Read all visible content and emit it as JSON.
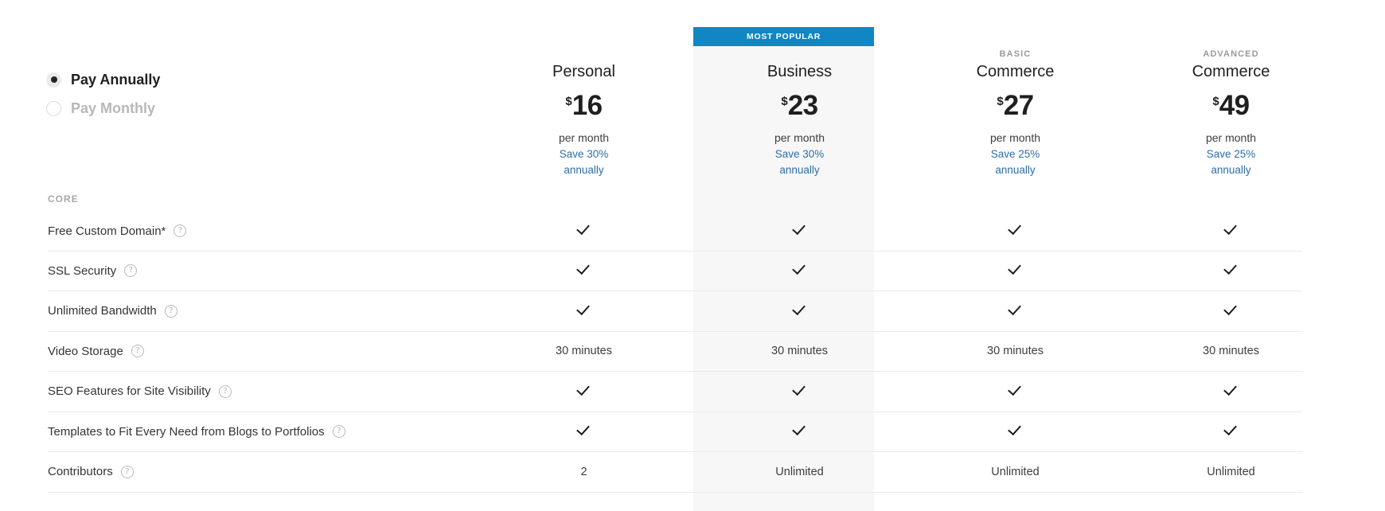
{
  "billing": {
    "options": [
      {
        "label": "Pay Annually",
        "selected": true
      },
      {
        "label": "Pay Monthly",
        "selected": false
      }
    ]
  },
  "popular_badge": "MOST POPULAR",
  "accent_color": "#1086c3",
  "link_color": "#2c6ea8",
  "highlight_color": "#f7f7f7",
  "plans": [
    {
      "eyebrow": "",
      "name": "Personal",
      "currency": "$",
      "amount": "16",
      "period": "per month",
      "save_line1": "Save 30%",
      "save_line2": "annually",
      "highlighted": false
    },
    {
      "eyebrow": "",
      "name": "Business",
      "currency": "$",
      "amount": "23",
      "period": "per month",
      "save_line1": "Save 30%",
      "save_line2": "annually",
      "highlighted": true
    },
    {
      "eyebrow": "BASIC",
      "name": "Commerce",
      "currency": "$",
      "amount": "27",
      "period": "per month",
      "save_line1": "Save 25%",
      "save_line2": "annually",
      "highlighted": false
    },
    {
      "eyebrow": "ADVANCED",
      "name": "Commerce",
      "currency": "$",
      "amount": "49",
      "period": "per month",
      "save_line1": "Save 25%",
      "save_line2": "annually",
      "highlighted": false
    }
  ],
  "section": {
    "label": "CORE"
  },
  "help_glyph": "?",
  "features": [
    {
      "label": "Free Custom Domain*",
      "has_help": true,
      "values": [
        "check",
        "check",
        "check",
        "check"
      ]
    },
    {
      "label": "SSL Security",
      "has_help": true,
      "values": [
        "check",
        "check",
        "check",
        "check"
      ]
    },
    {
      "label": "Unlimited Bandwidth",
      "has_help": true,
      "values": [
        "check",
        "check",
        "check",
        "check"
      ]
    },
    {
      "label": "Video Storage",
      "has_help": true,
      "values": [
        "30 minutes",
        "30 minutes",
        "30 minutes",
        "30 minutes"
      ]
    },
    {
      "label": "SEO Features for Site Visibility",
      "has_help": true,
      "values": [
        "check",
        "check",
        "check",
        "check"
      ]
    },
    {
      "label": "Templates to Fit Every Need from Blogs to Portfolios",
      "has_help": true,
      "values": [
        "check",
        "check",
        "check",
        "check"
      ]
    },
    {
      "label": "Contributors",
      "has_help": true,
      "values": [
        "2",
        "Unlimited",
        "Unlimited",
        "Unlimited"
      ]
    }
  ]
}
